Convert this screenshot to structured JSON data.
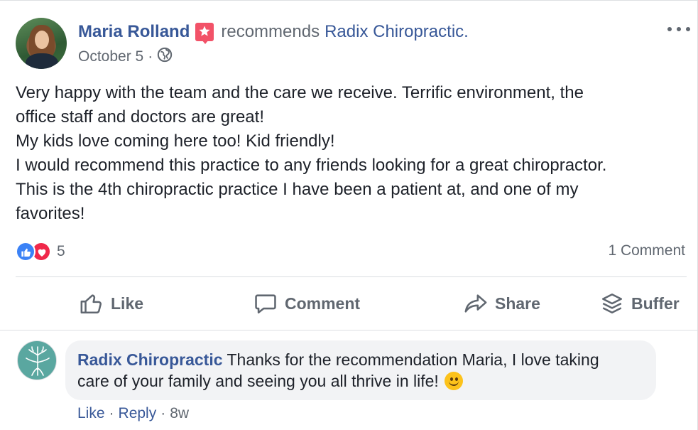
{
  "post": {
    "author": "Maria Rolland",
    "recommends_text": "recommends",
    "page": "Radix Chiropractic.",
    "date": "October 5",
    "separator": "·",
    "text_lines": [
      "Very happy with the team and the care we receive. Terrific environment, the",
      "office staff and doctors are great!",
      "My kids love coming here too! Kid friendly!",
      "I would recommend this practice to any friends looking for a great chiropractor.",
      "This is the 4th chiropractic practice I have been a patient at, and one of my",
      "favorites!"
    ],
    "reaction_count": "5",
    "comment_count": "1 Comment"
  },
  "actions": {
    "like": "Like",
    "comment": "Comment",
    "share": "Share",
    "buffer": "Buffer"
  },
  "comment": {
    "author": "Radix Chiropractic",
    "text_line1": " Thanks for the recommendation Maria, I love taking",
    "text_line2": "care of your family and seeing you all thrive in life! ",
    "like": "Like",
    "reply": "Reply",
    "separator": "·",
    "time": "8w"
  },
  "colors": {
    "link_blue": "#385898",
    "muted_gray": "#606770",
    "like_blue": "#3b82f6",
    "love_red": "#f0284a",
    "recommend_badge": "#f25268",
    "bubble_bg": "#f2f3f5"
  },
  "icons": [
    "ellipsis-icon",
    "recommend-star-icon",
    "globe-icon",
    "like-reaction-icon",
    "love-reaction-icon",
    "thumbs-up-icon",
    "comment-icon",
    "share-icon",
    "buffer-icon",
    "smiley-emoji-icon"
  ]
}
